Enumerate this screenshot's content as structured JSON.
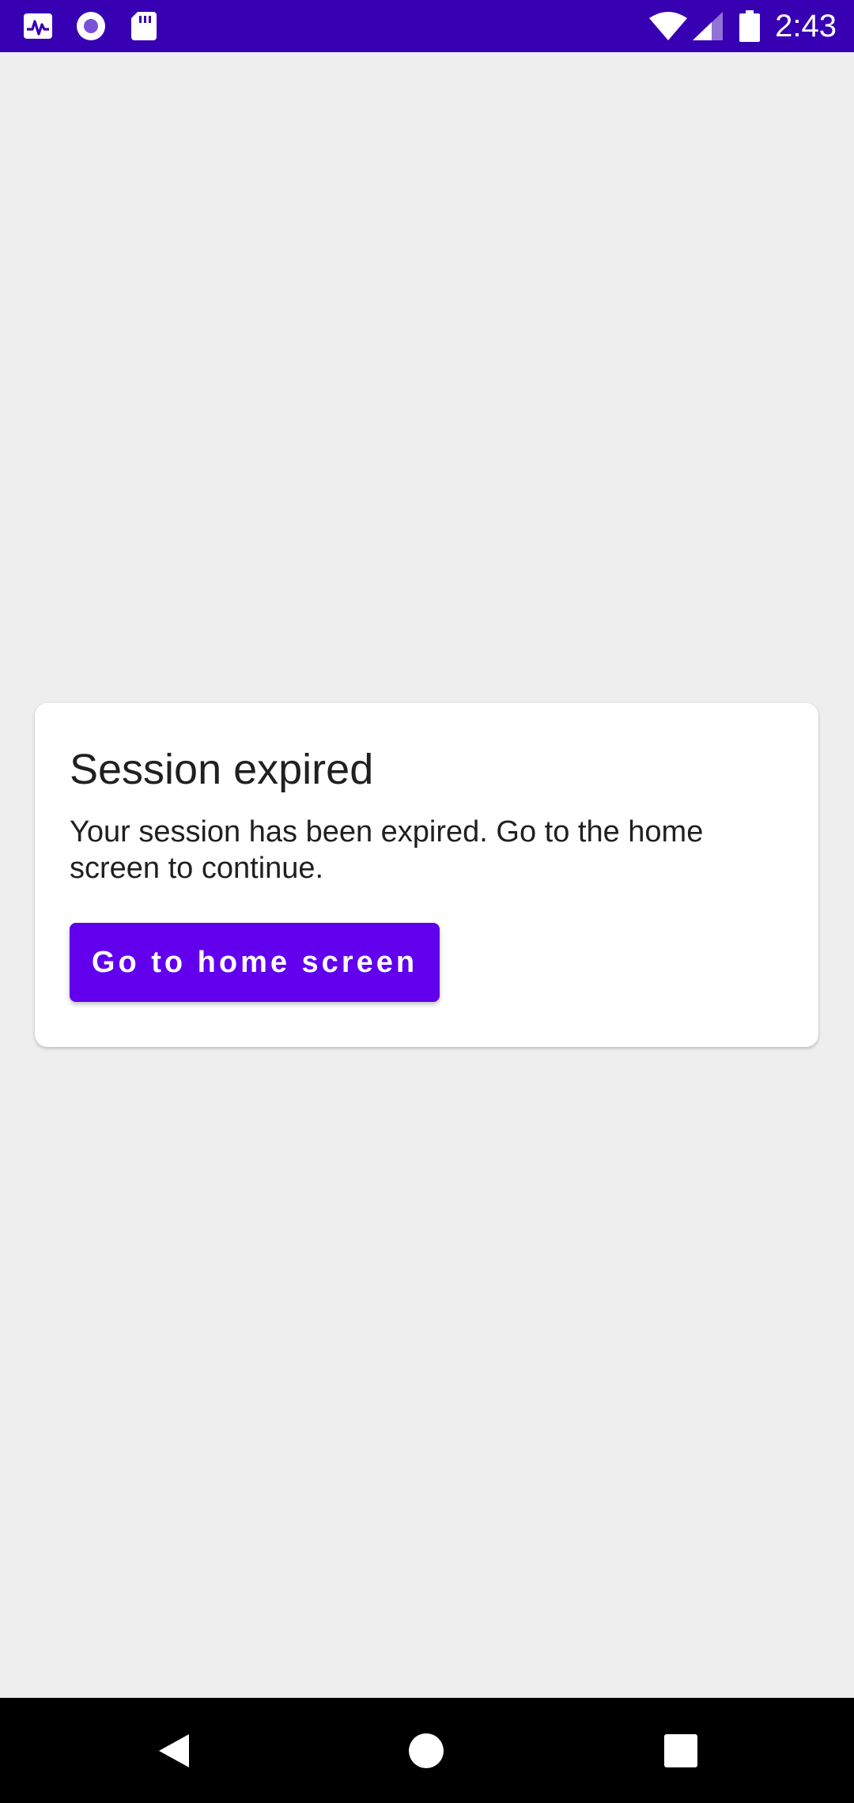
{
  "status_bar": {
    "time": "2:43",
    "background_color": "#3700b3",
    "left_icons": [
      "activity-icon",
      "record-icon",
      "sd-card-icon"
    ],
    "right_icons": [
      "wifi-icon",
      "signal-icon",
      "battery-icon"
    ]
  },
  "dialog": {
    "title": "Session expired",
    "message": "Your session has been expired. Go to the home screen to continue.",
    "button_label": "Go to home screen",
    "button_color": "#6200ee"
  },
  "nav_bar": {
    "buttons": [
      "back-icon",
      "home-icon",
      "recents-icon"
    ]
  }
}
